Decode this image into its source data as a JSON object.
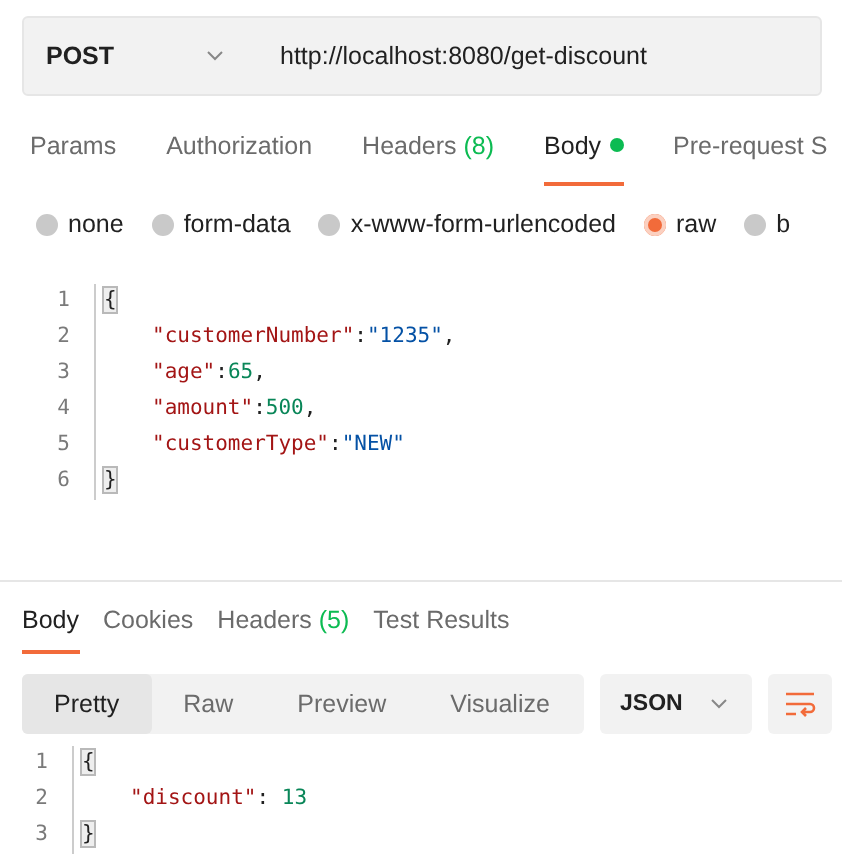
{
  "request": {
    "method": "POST",
    "url": "http://localhost:8080/get-discount"
  },
  "request_tabs": [
    {
      "label": "Params",
      "selected": false
    },
    {
      "label": "Authorization",
      "selected": false
    },
    {
      "label": "Headers",
      "count": "(8)",
      "selected": false
    },
    {
      "label": "Body",
      "selected": true,
      "dot": true
    },
    {
      "label": "Pre-request S",
      "selected": false
    }
  ],
  "body_types": [
    {
      "label": "none",
      "selected": false
    },
    {
      "label": "form-data",
      "selected": false
    },
    {
      "label": "x-www-form-urlencoded",
      "selected": false
    },
    {
      "label": "raw",
      "selected": true
    },
    {
      "label": "b",
      "selected": false
    }
  ],
  "request_body": [
    {
      "number": "1",
      "indented": false,
      "tokens": [
        {
          "text": "{",
          "kind": "bracket"
        }
      ]
    },
    {
      "number": "2",
      "indented": true,
      "tokens": [
        {
          "text": "\"customerNumber\"",
          "kind": "key"
        },
        {
          "text": ":",
          "kind": "punct"
        },
        {
          "text": "\"1235\"",
          "kind": "string"
        },
        {
          "text": ",",
          "kind": "punct"
        }
      ]
    },
    {
      "number": "3",
      "indented": true,
      "tokens": [
        {
          "text": "\"age\"",
          "kind": "key"
        },
        {
          "text": ":",
          "kind": "punct"
        },
        {
          "text": "65",
          "kind": "number"
        },
        {
          "text": ",",
          "kind": "punct"
        }
      ]
    },
    {
      "number": "4",
      "indented": true,
      "tokens": [
        {
          "text": "\"amount\"",
          "kind": "key"
        },
        {
          "text": ":",
          "kind": "punct"
        },
        {
          "text": "500",
          "kind": "number"
        },
        {
          "text": ",",
          "kind": "punct"
        }
      ]
    },
    {
      "number": "5",
      "indented": true,
      "tokens": [
        {
          "text": "\"customerType\"",
          "kind": "key"
        },
        {
          "text": ":",
          "kind": "punct"
        },
        {
          "text": "\"NEW\"",
          "kind": "string"
        }
      ]
    },
    {
      "number": "6",
      "indented": false,
      "tokens": [
        {
          "text": "}",
          "kind": "bracket"
        }
      ]
    }
  ],
  "response_tabs": [
    {
      "label": "Body",
      "selected": true
    },
    {
      "label": "Cookies",
      "selected": false
    },
    {
      "label": "Headers",
      "count": "(5)",
      "selected": false
    },
    {
      "label": "Test Results",
      "selected": false
    }
  ],
  "view_modes": [
    {
      "label": "Pretty",
      "selected": true
    },
    {
      "label": "Raw",
      "selected": false
    },
    {
      "label": "Preview",
      "selected": false
    },
    {
      "label": "Visualize",
      "selected": false
    }
  ],
  "format": "JSON",
  "response_body": [
    {
      "number": "1",
      "indented": false,
      "tokens": [
        {
          "text": "{",
          "kind": "bracket"
        }
      ]
    },
    {
      "number": "2",
      "indented": true,
      "tokens": [
        {
          "text": "\"discount\"",
          "kind": "key"
        },
        {
          "text": ": ",
          "kind": "punct"
        },
        {
          "text": "13",
          "kind": "number"
        }
      ]
    },
    {
      "number": "3",
      "indented": false,
      "tokens": [
        {
          "text": "}",
          "kind": "bracket"
        }
      ]
    }
  ]
}
